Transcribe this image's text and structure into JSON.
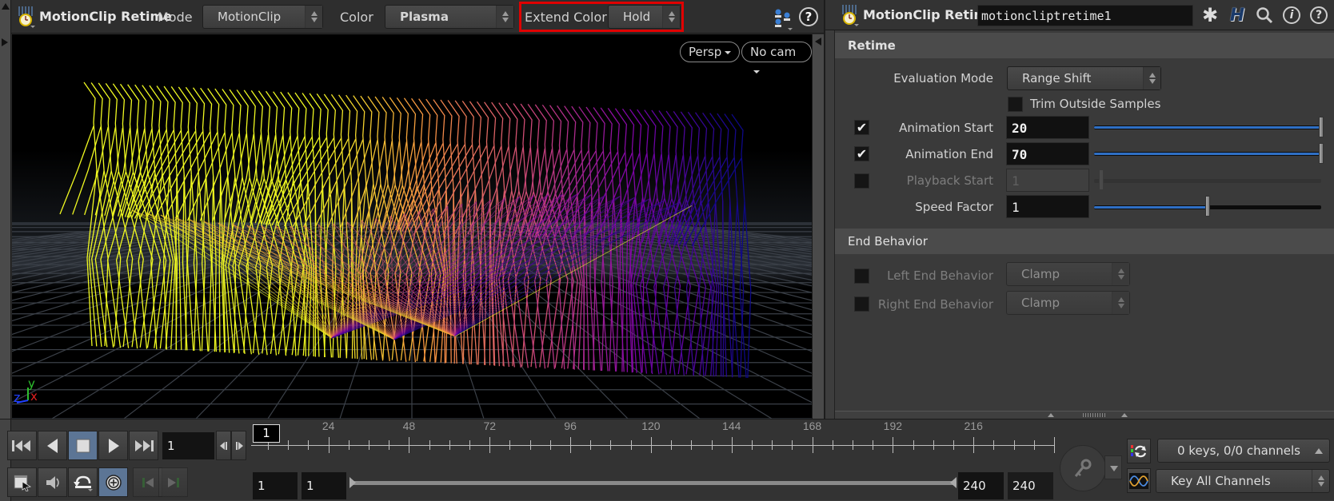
{
  "scene_viewer": {
    "node_type": "MotionClip Retime",
    "mode_label": "Mode",
    "mode_value": "MotionClip",
    "color_label": "Color",
    "color_value": "Plasma",
    "extend_color_label": "Extend Color",
    "extend_color_value": "Hold",
    "view_menu": "Persp",
    "camera_menu": "No cam",
    "axis_labels": {
      "x": "x",
      "y": "y",
      "z": "z"
    },
    "icons": [
      "node-type-icon",
      "display-options-icon",
      "help-icon"
    ]
  },
  "parameters": {
    "node_type": "MotionClip Retime",
    "node_name": "motioncliptretime1",
    "header_icons": [
      "gear-icon",
      "houdini-h-icon",
      "search-icon",
      "info-icon",
      "help-icon"
    ],
    "sections": {
      "retime": {
        "title": "Retime",
        "evaluation_mode_label": "Evaluation Mode",
        "evaluation_mode_value": "Range Shift",
        "trim_label": "Trim Outside Samples",
        "trim_checked": false,
        "animation_start": {
          "label": "Animation Start",
          "value": "20",
          "enabled": true,
          "slider_fraction": 1.0
        },
        "animation_end": {
          "label": "Animation End",
          "value": "70",
          "enabled": true,
          "slider_fraction": 1.0
        },
        "playback_start": {
          "label": "Playback Start",
          "value": "1",
          "enabled": false,
          "slider_fraction": 0.03
        },
        "speed_factor": {
          "label": "Speed Factor",
          "value": "1",
          "slider_fraction": 0.5
        }
      },
      "end_behavior": {
        "title": "End Behavior",
        "left": {
          "label": "Left End Behavior",
          "value": "Clamp",
          "enabled": false
        },
        "right": {
          "label": "Right End Behavior",
          "value": "Clamp",
          "enabled": false
        }
      }
    }
  },
  "playbar": {
    "current_frame": "1",
    "frame_marker": "1",
    "timeline_ticks": [
      "24",
      "48",
      "72",
      "96",
      "120",
      "144",
      "168",
      "192",
      "216"
    ],
    "timeline_range": [
      1,
      240
    ],
    "range_start_a": "1",
    "range_start_b": "1",
    "range_end_a": "240",
    "range_end_b": "240",
    "keys_status": "0 keys, 0/0 channels",
    "key_mode": "Key All Channels",
    "transport_buttons": [
      "jump-to-start",
      "play-reverse",
      "stop",
      "play-forward",
      "jump-to-end"
    ],
    "colors": {
      "accent_active": "#5c7595",
      "slider_fill": "#2f6fc4"
    }
  }
}
